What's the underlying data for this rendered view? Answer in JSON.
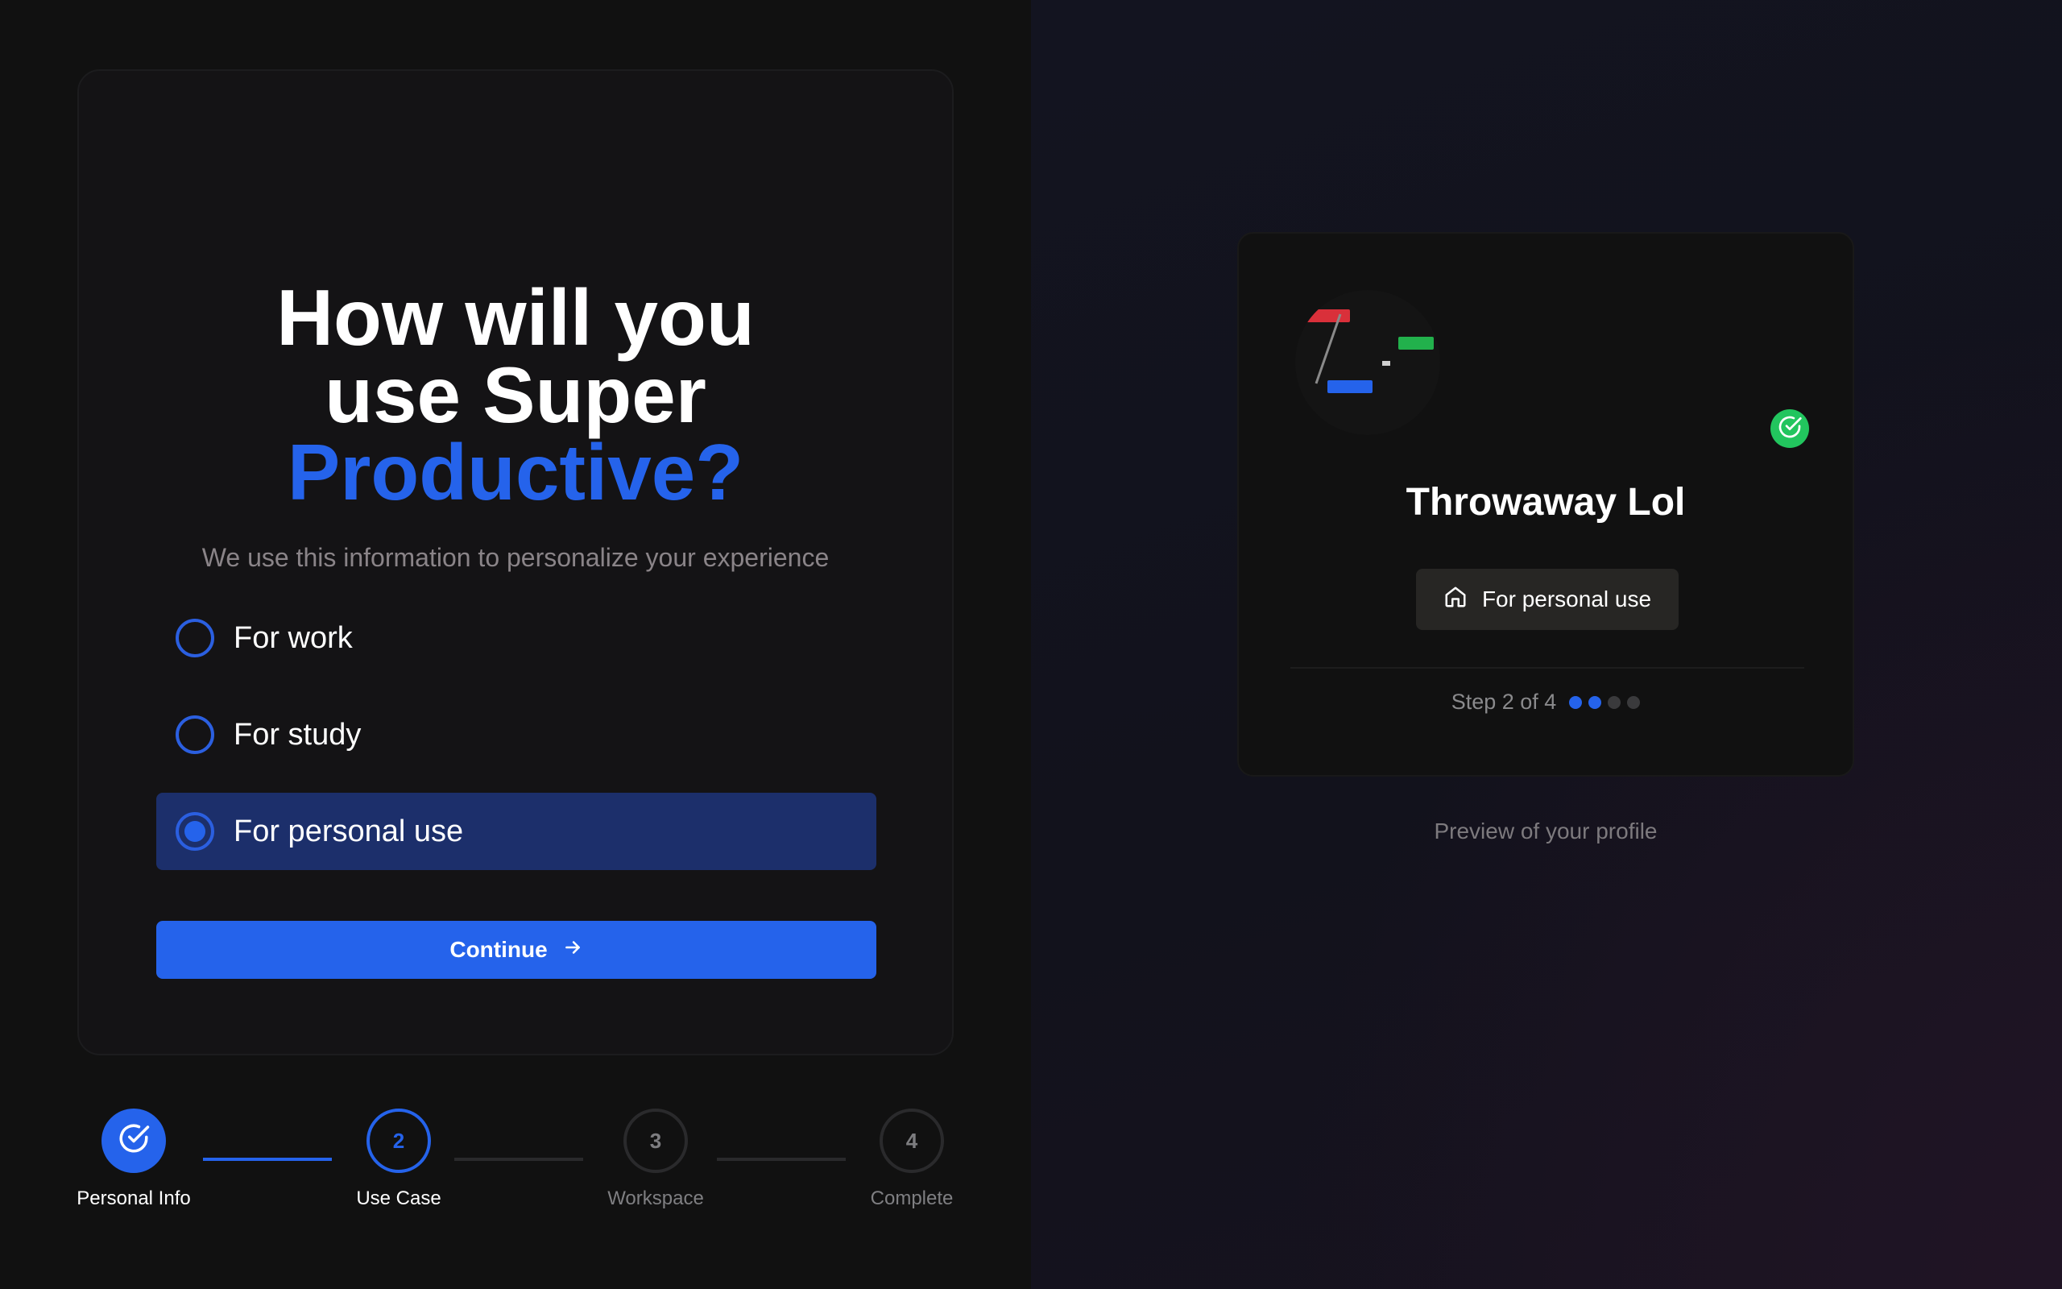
{
  "form": {
    "headline_line1": "How will you",
    "headline_line2": "use Super",
    "headline_accent": "Productive?",
    "subtitle": "We use this information to personalize your experience",
    "options": [
      {
        "label": "For work",
        "selected": false
      },
      {
        "label": "For study",
        "selected": false
      },
      {
        "label": "For personal use",
        "selected": true
      }
    ],
    "continue_label": "Continue"
  },
  "stepper": {
    "steps": [
      {
        "number": "",
        "label": "Personal Info",
        "state": "done"
      },
      {
        "number": "2",
        "label": "Use Case",
        "state": "active"
      },
      {
        "number": "3",
        "label": "Workspace",
        "state": "todo"
      },
      {
        "number": "4",
        "label": "Complete",
        "state": "todo"
      }
    ]
  },
  "preview": {
    "name": "Throwaway Lol",
    "use_case": "For personal use",
    "step_text": "Step 2 of 4",
    "current_step": 2,
    "total_steps": 4,
    "caption": "Preview of your profile"
  },
  "colors": {
    "accent": "#2563eb",
    "verified": "#22c55e",
    "selected_option_bg": "#1c2f6b"
  },
  "icons": {
    "continue": "arrow-right-icon",
    "step_done": "check-circle-icon",
    "verified": "check-circle-icon",
    "use_case": "home-icon"
  }
}
